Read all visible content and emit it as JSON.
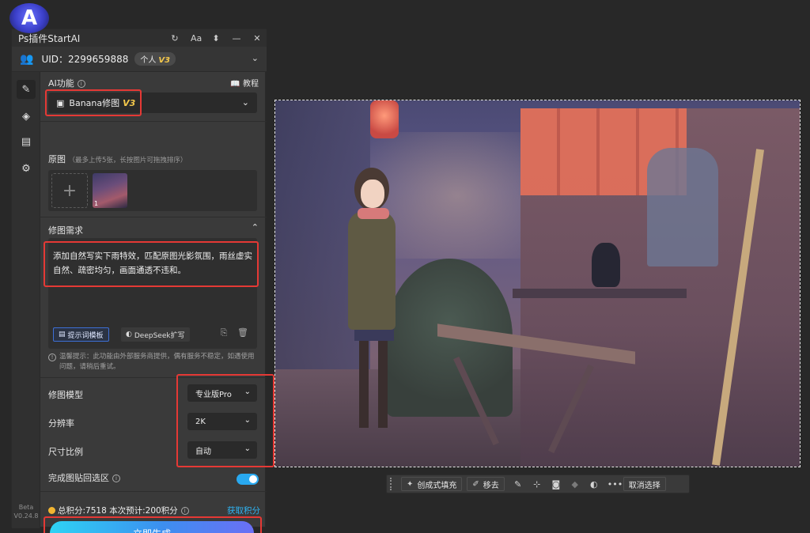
{
  "window": {
    "title": "Ps插件StartAI",
    "logo_letter": "A",
    "tools": {
      "refresh": "↻",
      "font": "Aa",
      "pin": "📌",
      "minimize": "—",
      "close": "✕"
    }
  },
  "user": {
    "uid_text": "UID：2299659888",
    "plan_label": "个人",
    "plan_tier": "V3"
  },
  "sidebar": {
    "items": [
      {
        "name": "edit-icon",
        "glyph": "✎"
      },
      {
        "name": "layers-icon",
        "glyph": "◈"
      },
      {
        "name": "document-icon",
        "glyph": "▤"
      },
      {
        "name": "settings-icon",
        "glyph": "⚙"
      }
    ],
    "version_line1": "Beta",
    "version_line2": "V0.24.8"
  },
  "ai_function": {
    "label": "AI功能",
    "tutorial_label": "教程",
    "selected_model": "Banana修图",
    "selected_tier": "V3"
  },
  "source_image": {
    "label": "原图",
    "hint": "（最多上传5张，长按图片可拖拽排序）",
    "add_glyph": "+",
    "thumb_number": "1"
  },
  "requirement": {
    "label": "修图需求",
    "text": "添加自然写实下雨特效，匹配原图光影氛围，雨丝虚实自然、疏密均匀，画面通透不违和。",
    "template_button": "提示词模板",
    "deepseek_button": "DeepSeek扩写"
  },
  "notice": {
    "text": "温馨提示：此功能由外部服务商提供，偶有服务不稳定，如遇使用问题，请稍后重试。"
  },
  "options": {
    "model_label": "修图模型",
    "model_value": "专业版Pro",
    "resolution_label": "分辨率",
    "resolution_value": "2K",
    "aspect_label": "尺寸比例",
    "aspect_value": "自动",
    "paste_label": "完成图贴回选区",
    "paste_enabled": true
  },
  "points": {
    "summary": "总积分:7518  本次预计:200积分",
    "get_points": "获取积分"
  },
  "generate_button": "立即生成",
  "context_toolbar": {
    "generative_fill": "创成式填充",
    "remove": "移去",
    "cancel_selection": "取消选择",
    "more": "•••"
  },
  "colors": {
    "accent_blue": "#29a9f0",
    "highlight_red": "#e53935",
    "gold_tier": "#f3c74b"
  }
}
